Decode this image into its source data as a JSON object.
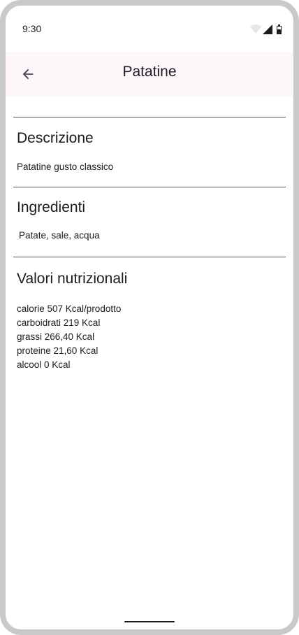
{
  "status_bar": {
    "time": "9:30",
    "icons": [
      "wifi-icon",
      "signal-icon",
      "battery-icon"
    ]
  },
  "app_bar": {
    "title": "Patatine",
    "back_icon": "arrow-back-icon"
  },
  "sections": {
    "description": {
      "heading": "Descrizione",
      "text": "Patatine gusto classico"
    },
    "ingredients": {
      "heading": "Ingredienti",
      "text": "Patate, sale, acqua"
    },
    "nutrition": {
      "heading": "Valori nutrizionali",
      "lines": [
        "calorie 507 Kcal/prodotto",
        "carboidrati 219 Kcal",
        "grassi 266,40 Kcal",
        "proteine 21,60 Kcal",
        "alcool 0 Kcal"
      ]
    }
  }
}
